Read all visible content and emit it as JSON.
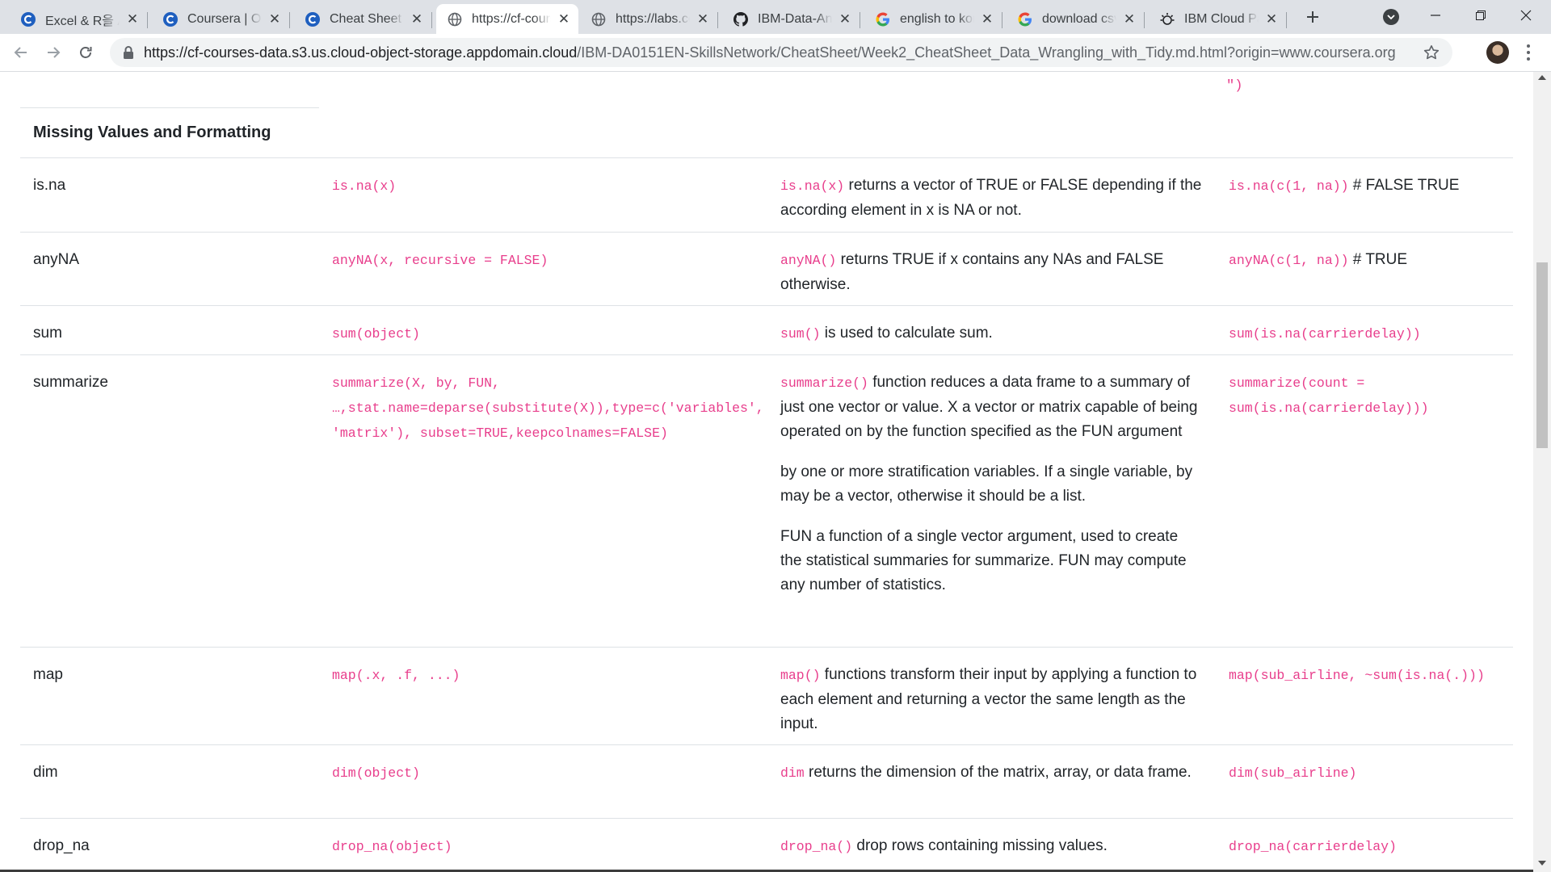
{
  "tabs": [
    {
      "title": "Excel & R을 A",
      "icon": "coursera-icon"
    },
    {
      "title": "Coursera | Online",
      "icon": "coursera-icon"
    },
    {
      "title": "Cheat Sheet - ",
      "icon": "coursera-icon"
    },
    {
      "title": "https://cf-cours",
      "icon": "globe-icon",
      "active": true
    },
    {
      "title": "https://labs.cog",
      "icon": "globe-icon"
    },
    {
      "title": "IBM-Data-Anal",
      "icon": "github-icon"
    },
    {
      "title": "english to kore",
      "icon": "google-icon"
    },
    {
      "title": "download csv",
      "icon": "google-icon"
    },
    {
      "title": "IBM Cloud Pak",
      "icon": "ibm-cloud-icon"
    }
  ],
  "address_bar": {
    "host": "https://cf-courses-data.s3.us.cloud-object-storage.appdomain.cloud",
    "path": "/IBM-DA0151EN-SkillsNetwork/CheatSheet/Week2_CheatSheet_Data_Wrangling_with_Tidy.md.html?origin=www.coursera.org"
  },
  "page": {
    "prev_row_tail": "\")",
    "section_title": "Missing Values and Formatting",
    "rows": [
      {
        "name": "is.na",
        "syntax": "is.na(x)",
        "desc_code": "is.na(x)",
        "desc_text": " returns a vector of TRUE or FALSE depending if the according element in x is NA or not.",
        "example_code": "is.na(c(1, na))",
        "example_text": " # FALSE TRUE"
      },
      {
        "name": "anyNA",
        "syntax": "anyNA(x, recursive = FALSE)",
        "desc_code": "anyNA()",
        "desc_text": " returns TRUE if x contains any NAs and FALSE otherwise.",
        "example_code": "anyNA(c(1, na))",
        "example_text": " # TRUE"
      },
      {
        "name": "sum",
        "syntax": "sum(object)",
        "desc_code": "sum()",
        "desc_text": " is used to calculate sum.",
        "example_code": "sum(is.na(carrierdelay))",
        "example_text": ""
      },
      {
        "name": "summarize",
        "syntax": "summarize(X, by, FUN, …,stat.name=deparse(substitute(X)),type=c('variables', 'matrix'), subset=TRUE,keepcolnames=FALSE)",
        "desc_code": "summarize()",
        "desc_text": " function reduces a data frame to a summary of just one vector or value. X a vector or matrix capable of being operated on by the function specified as the FUN argument",
        "desc_p2": "by one or more stratification variables. If a single variable, by may be a vector, otherwise it should be a list.",
        "desc_p3": "FUN a function of a single vector argument, used to create the statistical summaries for summarize. FUN may compute any number of statistics.",
        "example_code": "summarize(count = sum(is.na(carrierdelay)))",
        "example_text": ""
      },
      {
        "name": "map",
        "syntax": "map(.x, .f, ...)",
        "desc_code": "map()",
        "desc_text": " functions transform their input by applying a function to each element and returning a vector the same length as the input.",
        "example_code": "map(sub_airline, ~sum(is.na(.)))",
        "example_text": ""
      },
      {
        "name": "dim",
        "syntax": "dim(object)",
        "desc_code": "dim",
        "desc_text": " returns the dimension of the matrix, array, or data frame.",
        "example_code": "dim(sub_airline)",
        "example_text": ""
      },
      {
        "name": "drop_na",
        "syntax": "drop_na(object)",
        "desc_code": "drop_na()",
        "desc_text": " drop rows containing missing values.",
        "example_code": "drop_na(carrierdelay)",
        "example_text": ""
      }
    ]
  }
}
